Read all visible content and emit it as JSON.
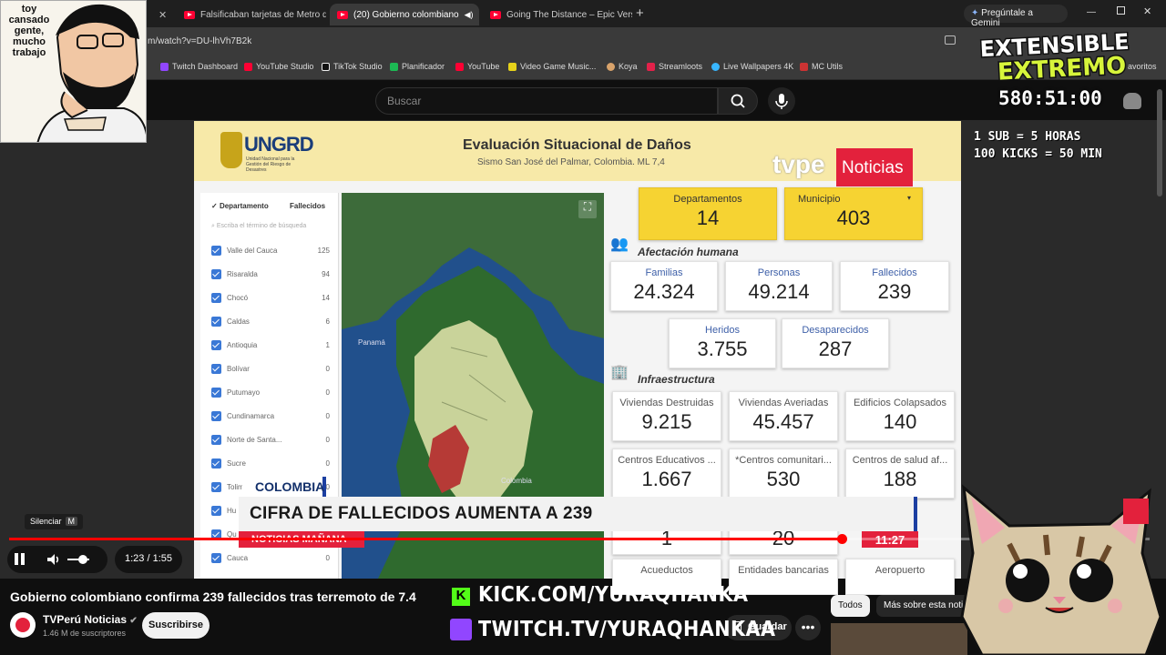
{
  "browser": {
    "tabs": [
      {
        "title": "Falsificaban tarjetas de Metro d",
        "active": false
      },
      {
        "title": "(20) Gobierno colombiano",
        "active": true
      },
      {
        "title": "Going The Distance – Epic Versi",
        "active": false
      }
    ],
    "gemini_label": "Pregúntale a Gemini",
    "url": "m/watch?v=DU-lhVh7B2k",
    "bookmarks": [
      "Twitch Dashboard",
      "YouTube Studio",
      "TikTok Studio",
      "Planificador",
      "YouTube",
      "Video Game Music...",
      "Koya",
      "Streamloots",
      "Live Wallpapers 4K",
      "MC Utils"
    ],
    "bookmarks_more": "avoritos"
  },
  "youtube": {
    "search_placeholder": "Buscar",
    "video_title": "Gobierno colombiano confirma 239 fallecidos tras terremoto de 7.4",
    "channel_name": "TVPerú Noticias",
    "channel_subs": "1.46 M de suscriptores",
    "subscribe_label": "Suscribirse",
    "save_label": "Guardar",
    "more_label": "•••",
    "chips": [
      "Todos",
      "Más sobre esta noticia"
    ],
    "mute_tooltip": "Silenciar",
    "mute_key": "M",
    "time_display": "1:23 / 1:55",
    "progress": 0.73
  },
  "video": {
    "ungrd_name": "UNGRD",
    "ungrd_sub": "Unidad Nacional para la Gestión del Riesgo de Desastres",
    "title": "Evaluación Situacional de Daños",
    "subtitle": "Sismo San José del Palmar, Colombia. ML 7,4",
    "tvpe_word": "tvpe",
    "tvpe_noticias": "Noticias",
    "filter": {
      "col1": "Departamento",
      "col2": "Fallecidos",
      "search": "Escriba el término de búsqueda",
      "rows": [
        {
          "name": "Valle del Cauca",
          "value": "125"
        },
        {
          "name": "Risaralda",
          "value": "94"
        },
        {
          "name": "Chocó",
          "value": "14"
        },
        {
          "name": "Caldas",
          "value": "6"
        },
        {
          "name": "Antioquia",
          "value": "1"
        },
        {
          "name": "Bolívar",
          "value": "0"
        },
        {
          "name": "Putumayo",
          "value": "0"
        },
        {
          "name": "Cundinamarca",
          "value": "0"
        },
        {
          "name": "Norte de Santa...",
          "value": "0"
        },
        {
          "name": "Sucre",
          "value": "0"
        },
        {
          "name": "Tolim",
          "value": "0"
        },
        {
          "name": "Hu",
          "value": "0"
        },
        {
          "name": "Qu",
          "value": "0"
        },
        {
          "name": "Cauca",
          "value": "0"
        }
      ]
    },
    "map_labels": {
      "panama": "Panamá",
      "colombia": "Colombia"
    },
    "top_cards": [
      {
        "label": "Departamentos",
        "value": "14"
      },
      {
        "label": "Municipio",
        "value": "403"
      }
    ],
    "section_human": "Afectación humana",
    "human_cards": [
      {
        "label": "Familias",
        "value": "24.324"
      },
      {
        "label": "Personas",
        "value": "49.214"
      },
      {
        "label": "Fallecidos",
        "value": "239"
      },
      {
        "label": "Heridos",
        "value": "3.755"
      },
      {
        "label": "Desaparecidos",
        "value": "287"
      }
    ],
    "section_infra": "Infraestructura",
    "infra_cards": [
      {
        "label": "Viviendas Destruidas",
        "value": "9.215"
      },
      {
        "label": "Viviendas Averiadas",
        "value": "45.457"
      },
      {
        "label": "Edificios Colapsados",
        "value": "140"
      },
      {
        "label": "Centros Educativos ...",
        "value": "1.667"
      },
      {
        "label": "*Centros comunitari...",
        "value": "530"
      },
      {
        "label": "Centros de salud af...",
        "value": "188"
      },
      {
        "label": "",
        "value": "1"
      },
      {
        "label": "",
        "value": "20"
      },
      {
        "label": "Acueductos",
        "value": ""
      },
      {
        "label": "Entidades bancarias",
        "value": ""
      },
      {
        "label": "Aeropuerto",
        "value": ""
      }
    ],
    "lower_third": {
      "tag": "COLOMBIA",
      "headline": "CIFRA DE FALLECIDOS AUMENTA A 239",
      "program": "NOTICIAS MAÑANA",
      "clock": "11:27"
    }
  },
  "overlay": {
    "streamer_text": "toy cansado gente, mucho trabajo",
    "logo_line1": "EXTENSIBLE",
    "logo_line2": "EXTREMO",
    "timer": "580:51:00",
    "rule1": "1 SUB = 5 HORAS",
    "rule2": "100 KICKS = 50 MIN",
    "kick_url": "KICK.COM/YURAQHANKA",
    "twitch_url": "TWITCH.TV/YURAQHANKAA"
  },
  "colors": {
    "accent_red": "#ff0000",
    "tvpe_red": "#e3213c",
    "kick_green": "#53fc18",
    "twitch_purple": "#9146ff",
    "card_yellow": "#f6d332"
  }
}
